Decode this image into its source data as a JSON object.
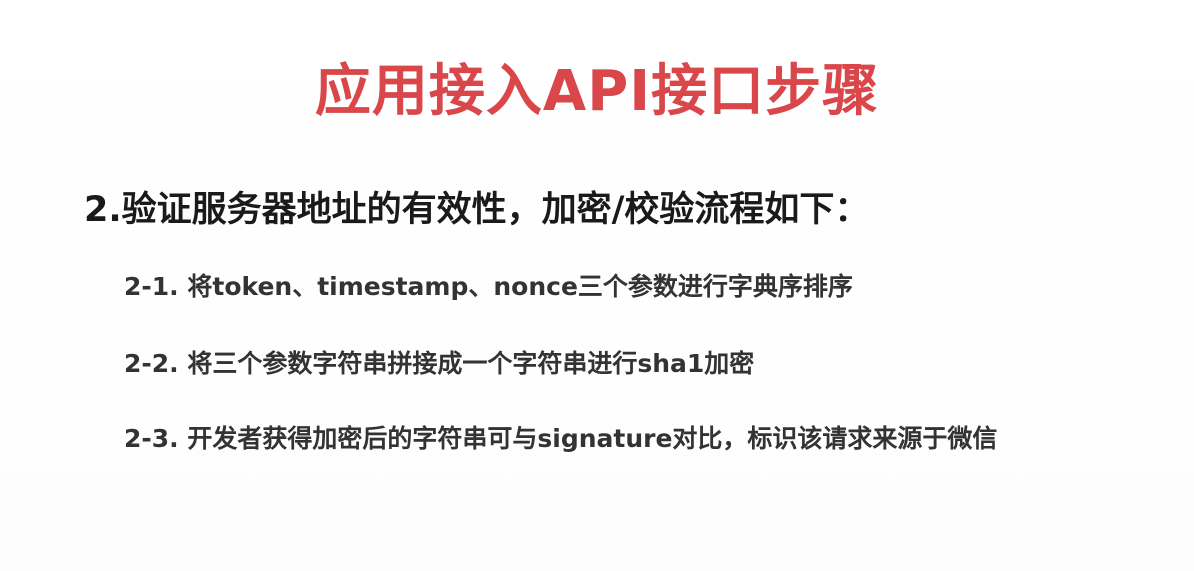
{
  "slide": {
    "title": "应用接入API接口步骤",
    "heading": "2.验证服务器地址的有效性，加密/校验流程如下：",
    "steps": [
      "2-1. 将token、timestamp、nonce三个参数进行字典序排序",
      "2-2. 将三个参数字符串拼接成一个字符串进行sha1加密",
      "2-3. 开发者获得加密后的字符串可与signature对比，标识该请求来源于微信"
    ]
  },
  "colors": {
    "title": "#d9474a",
    "heading": "#1a1a1a",
    "steps": "#333333",
    "background": "#ffffff"
  }
}
